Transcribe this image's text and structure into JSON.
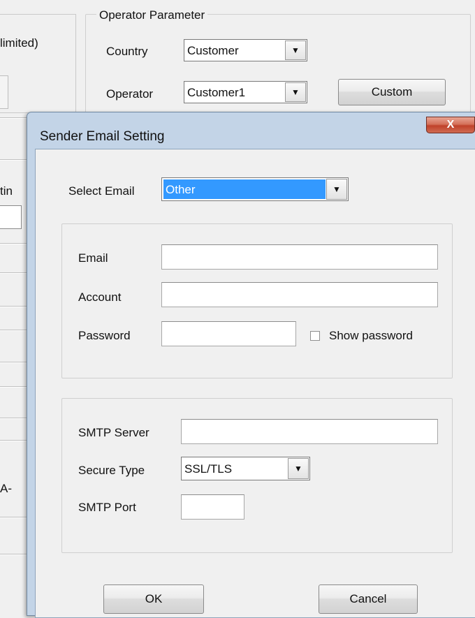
{
  "background_window": {
    "left_frame_text": "limited)",
    "left_strip_fragments": [
      "tin",
      "A-"
    ],
    "operator_group": {
      "title": "Operator Parameter",
      "country_label": "Country",
      "country_value": "Customer",
      "operator_label": "Operator",
      "operator_value": "Customer1",
      "custom_button": "Custom"
    }
  },
  "dialog": {
    "title": "Sender Email Setting",
    "close_glyph": "X",
    "select_email_label": "Select Email",
    "select_email_value": "Other",
    "account_group": {
      "email_label": "Email",
      "email_value": "",
      "account_label": "Account",
      "account_value": "",
      "password_label": "Password",
      "password_value": "",
      "show_password_label": "Show password",
      "show_password_checked": false
    },
    "smtp_group": {
      "server_label": "SMTP Server",
      "server_value": "",
      "secure_type_label": "Secure Type",
      "secure_type_value": "SSL/TLS",
      "port_label": "SMTP Port",
      "port_value": ""
    },
    "ok_button": "OK",
    "cancel_button": "Cancel"
  },
  "colors": {
    "selection_highlight": "#3399ff",
    "dialog_frame": "#c3d4e7",
    "close_button": "#c75a43"
  },
  "icons": {
    "dropdown": "chevron-down-icon",
    "close": "close-icon"
  }
}
